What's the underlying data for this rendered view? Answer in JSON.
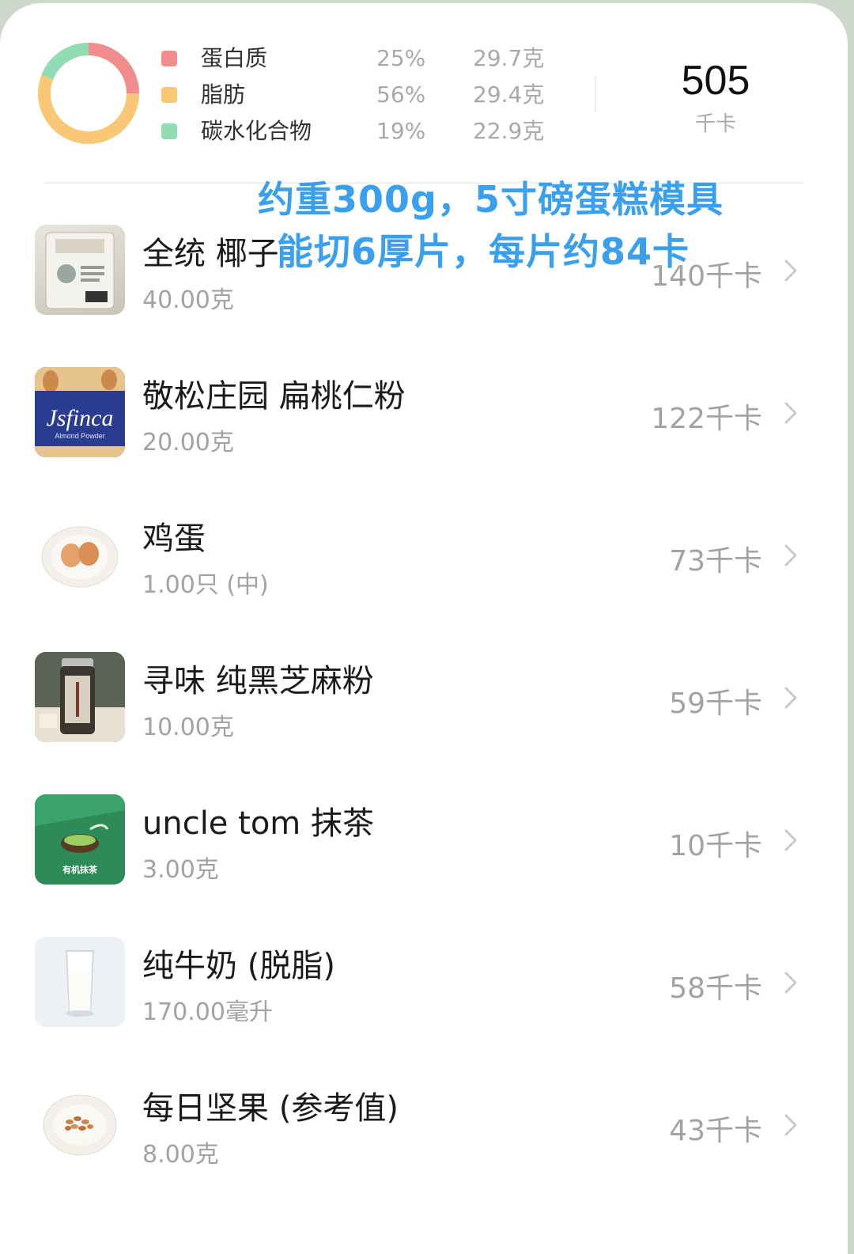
{
  "summary": {
    "macros": [
      {
        "name": "蛋白质",
        "percent": "25%",
        "amount": "29.7克",
        "color": "#f28b8b"
      },
      {
        "name": "脂肪",
        "percent": "56%",
        "amount": "29.4克",
        "color": "#f9c877"
      },
      {
        "name": "碳水化合物",
        "percent": "19%",
        "amount": "22.9克",
        "color": "#8fdcb5"
      }
    ],
    "total_kcal": "505",
    "total_unit": "千卡"
  },
  "annotation": {
    "line1": "约重300g，5寸磅蛋糕模具",
    "line2": "能切6厚片，每片约84卡"
  },
  "foods": [
    {
      "name": "全统 椰子",
      "amount": "40.00克",
      "kcal": "140千卡",
      "icon": "coconut-flour-bag-icon"
    },
    {
      "name": "敬松庄园 扁桃仁粉",
      "amount": "20.00克",
      "kcal": "122千卡",
      "icon": "almond-flour-bag-icon",
      "brand": "Jsfinca",
      "sub": "Almond Powder"
    },
    {
      "name": "鸡蛋",
      "amount": "1.00只 (中)",
      "kcal": "73千卡",
      "icon": "egg-plate-icon"
    },
    {
      "name": "寻味 纯黑芝麻粉",
      "amount": "10.00克",
      "kcal": "59千卡",
      "icon": "sesame-jar-icon"
    },
    {
      "name": "uncle tom 抹茶",
      "amount": "3.00克",
      "kcal": "10千卡",
      "icon": "matcha-bag-icon",
      "label": "有机抹茶"
    },
    {
      "name": "纯牛奶 (脱脂)",
      "amount": "170.00毫升",
      "kcal": "58千卡",
      "icon": "milk-glass-icon"
    },
    {
      "name": "每日坚果 (参考值)",
      "amount": "8.00克",
      "kcal": "43千卡",
      "icon": "nuts-plate-icon"
    }
  ]
}
